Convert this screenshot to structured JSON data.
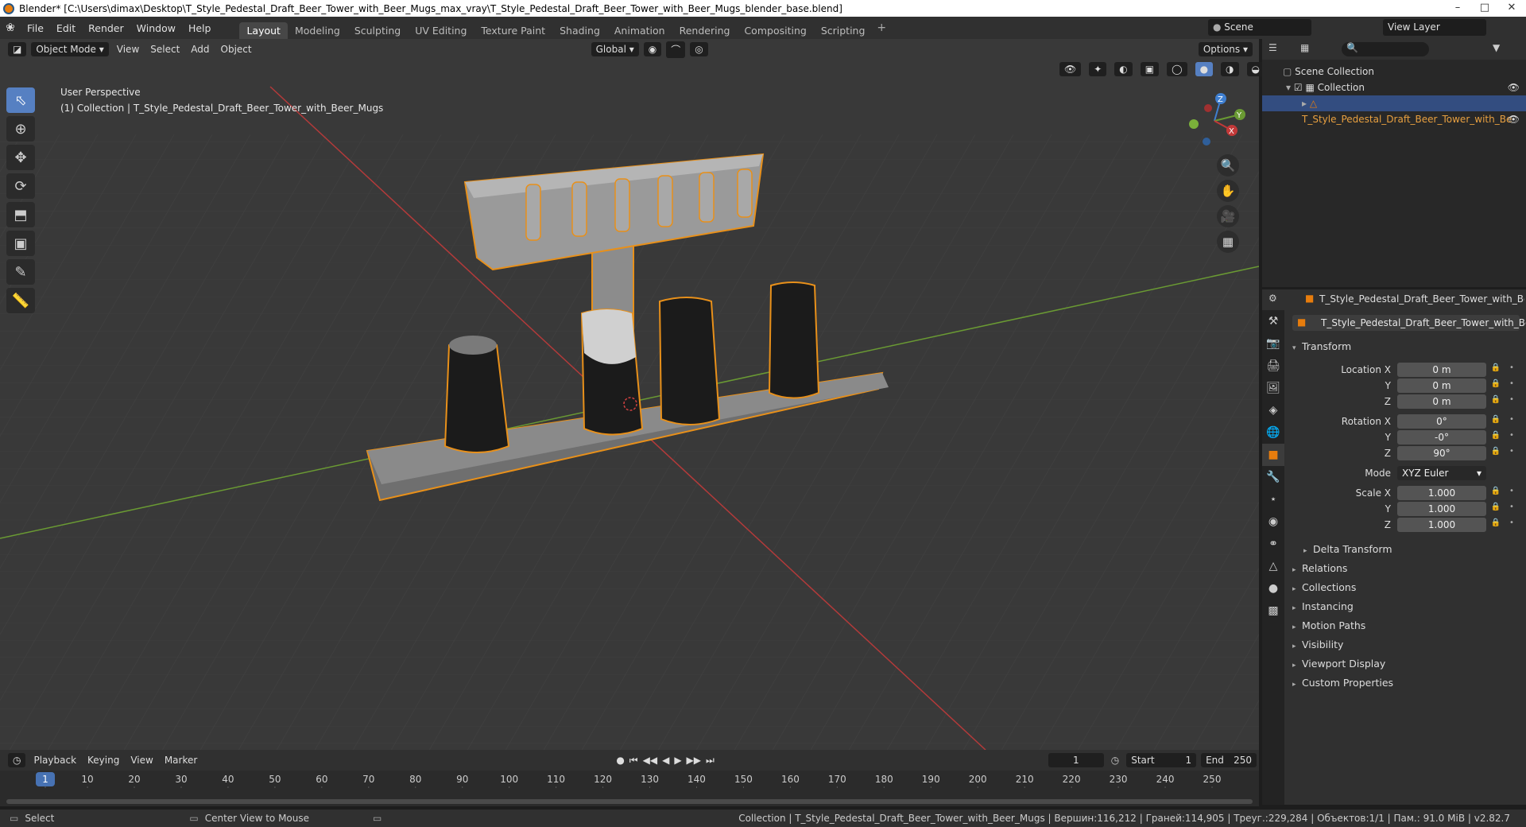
{
  "window": {
    "title": "Blender* [C:\\Users\\dimax\\Desktop\\T_Style_Pedestal_Draft_Beer_Tower_with_Beer_Mugs_max_vray\\T_Style_Pedestal_Draft_Beer_Tower_with_Beer_Mugs_blender_base.blend]"
  },
  "menu": [
    "File",
    "Edit",
    "Render",
    "Window",
    "Help"
  ],
  "workspaces": [
    "Layout",
    "Modeling",
    "Sculpting",
    "UV Editing",
    "Texture Paint",
    "Shading",
    "Animation",
    "Rendering",
    "Compositing",
    "Scripting"
  ],
  "scene": {
    "scene_name": "Scene",
    "view_layer": "View Layer"
  },
  "viewport_header": {
    "mode": "Object Mode",
    "menus": [
      "View",
      "Select",
      "Add",
      "Object"
    ],
    "transform_orientation": "Global",
    "options_label": "Options"
  },
  "viewport": {
    "perspective": "User Perspective",
    "collection_info": "(1) Collection | T_Style_Pedestal_Draft_Beer_Tower_with_Beer_Mugs",
    "gizmo_axes": [
      "Z",
      "Y",
      "X"
    ]
  },
  "outliner": {
    "scene_collection": "Scene Collection",
    "collection": "Collection",
    "object": "T_Style_Pedestal_Draft_Beer_Tower_with_Be"
  },
  "properties": {
    "object_header": "T_Style_Pedestal_Draft_Beer_Tower_with_Beer_Mu",
    "object_name_field": "T_Style_Pedestal_Draft_Beer_Tower_with_Beer_...",
    "transform_title": "Transform",
    "location_x_label": "Location X",
    "location": [
      "0 m",
      "0 m",
      "0 m"
    ],
    "rotation_x_label": "Rotation X",
    "rotation": [
      "0°",
      "-0°",
      "90°"
    ],
    "mode_label": "Mode",
    "rotation_mode": "XYZ Euler",
    "scale_x_label": "Scale X",
    "scale": [
      "1.000",
      "1.000",
      "1.000"
    ],
    "axis_y": "Y",
    "axis_z": "Z",
    "delta_transform": "Delta Transform",
    "sections": [
      "Relations",
      "Collections",
      "Instancing",
      "Motion Paths",
      "Visibility",
      "Viewport Display",
      "Custom Properties"
    ]
  },
  "timeline": {
    "menus": [
      "Playback",
      "Keying",
      "View",
      "Marker"
    ],
    "current_frame": "1",
    "start_label": "Start",
    "start": "1",
    "end_label": "End",
    "end": "250",
    "ruler": [
      "1",
      "10",
      "20",
      "30",
      "40",
      "50",
      "60",
      "70",
      "80",
      "90",
      "100",
      "110",
      "120",
      "130",
      "140",
      "150",
      "160",
      "170",
      "180",
      "190",
      "200",
      "210",
      "220",
      "230",
      "240",
      "250"
    ]
  },
  "statusbar": {
    "select": "Select",
    "center_view": "Center View to Mouse",
    "info": "Collection | T_Style_Pedestal_Draft_Beer_Tower_with_Beer_Mugs | Вершин:116,212 | Граней:114,905 | Треуг.:229,284 | Объектов:1/1 | Пам.: 91.0 MiB | v2.82.7"
  },
  "colors": {
    "accent": "#e87d0d",
    "selection_blue": "#5680c2",
    "x_axis": "#c23838",
    "y_axis": "#6a9a33"
  }
}
